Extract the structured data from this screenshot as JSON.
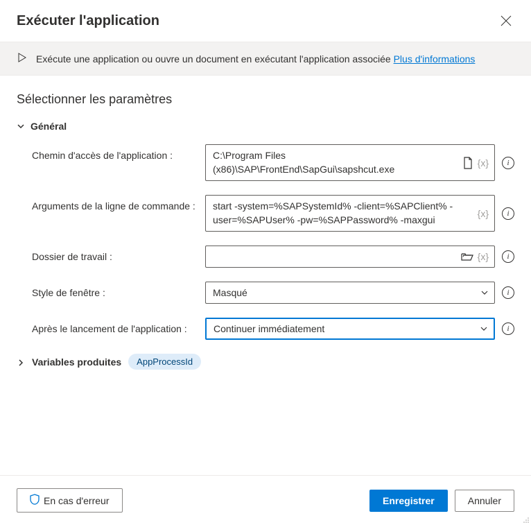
{
  "header": {
    "title": "Exécuter l'application"
  },
  "info": {
    "text": "Exécute une application ou ouvre un document en exécutant l'application associée ",
    "link": "Plus d'informations"
  },
  "section_title": "Sélectionner les paramètres",
  "group": {
    "label": "Général"
  },
  "fields": {
    "app_path": {
      "label": "Chemin d'accès de l'application :",
      "value": "C:\\Program Files (x86)\\SAP\\FrontEnd\\SapGui\\sapshcut.exe"
    },
    "cmd_args": {
      "label": "Arguments de la ligne de commande :",
      "value": "start -system=%SAPSystemId% -client=%SAPClient% -user=%SAPUser% -pw=%SAPPassword% -maxgui"
    },
    "work_dir": {
      "label": "Dossier de travail :",
      "value": ""
    },
    "window_style": {
      "label": "Style de fenêtre :",
      "value": "Masqué"
    },
    "after_launch": {
      "label": "Après le lancement de l'application :",
      "value": "Continuer immédiatement"
    }
  },
  "variables": {
    "label": "Variables produites",
    "pill": "AppProcessId"
  },
  "footer": {
    "error": "En cas d'erreur",
    "save": "Enregistrer",
    "cancel": "Annuler"
  }
}
